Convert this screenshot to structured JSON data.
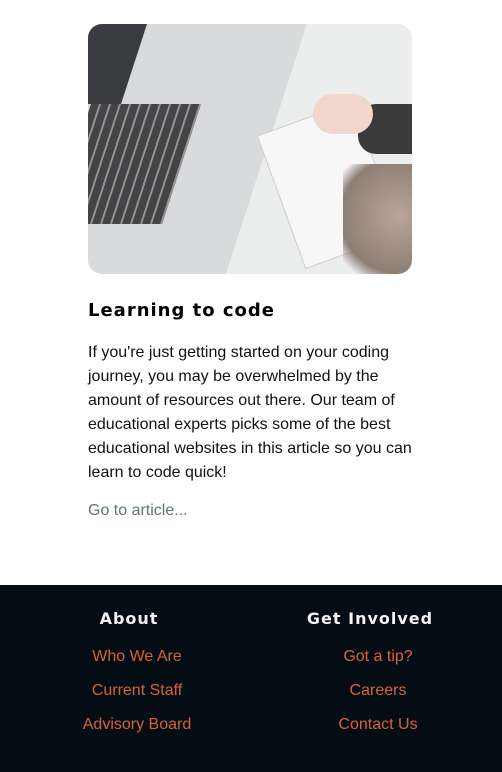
{
  "article": {
    "title": "Learning to code",
    "body": "If you're just getting started on your coding journey, you may be overwhelmed by the amount of resources out there. Our team of educational experts picks some of the best educational websites in this article so you can learn to code quick!",
    "link": "Go to article..."
  },
  "footer": {
    "columns": [
      {
        "heading": "About",
        "links": [
          "Who We Are",
          "Current Staff",
          "Advisory Board"
        ]
      },
      {
        "heading": "Get Involved",
        "links": [
          "Got a tip?",
          "Careers",
          "Contact Us"
        ]
      }
    ]
  },
  "colors": {
    "footer_bg": "#050d14",
    "link": "#d8613a",
    "muted_link": "#5f7577"
  }
}
